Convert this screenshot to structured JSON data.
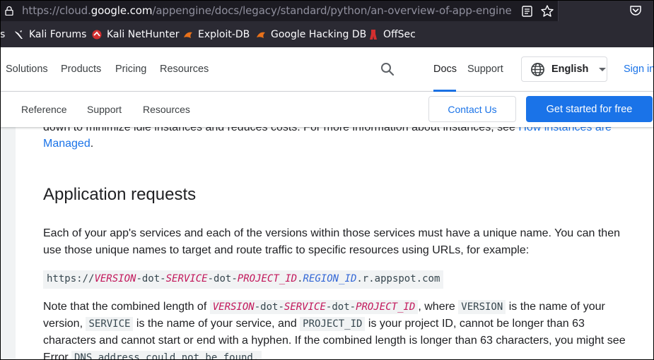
{
  "browser": {
    "url_prefix": "https://cloud.",
    "url_host": "google.com",
    "url_path": "/appengine/docs/legacy/standard/python/an-overview-of-app-engine",
    "bookmarks": [
      {
        "label": "s",
        "icon": "truncated"
      },
      {
        "label": "Kali Forums",
        "icon": "kali-forums-icon"
      },
      {
        "label": "Kali NetHunter",
        "icon": "nethunter-icon"
      },
      {
        "label": "Exploit-DB",
        "icon": "exploitdb-icon"
      },
      {
        "label": "Google Hacking DB",
        "icon": "ghdb-icon"
      },
      {
        "label": "OffSec",
        "icon": "offsec-icon"
      }
    ]
  },
  "topnav": {
    "links": [
      "Solutions",
      "Products",
      "Pricing",
      "Resources"
    ],
    "docs": "Docs",
    "support": "Support",
    "language": "English",
    "signin": "Sign in"
  },
  "subnav": {
    "links": [
      "Reference",
      "Support",
      "Resources"
    ],
    "contact": "Contact Us",
    "get_started": "Get started for free"
  },
  "article": {
    "top_text": "down to minimize idle instances and reduces costs. For more information about instances, see ",
    "top_link_1": "How instances are",
    "top_link_2": "Managed",
    "heading": "Application requests",
    "para1_line1": "Each of your app's services and each of the versions within those services must have a unique name. You can then",
    "para1_line2": "use those unique names to target and route traffic to specific resources using URLs, for example:",
    "url_example": {
      "scheme": "https://",
      "version": "VERSION",
      "dot1": "-dot-",
      "service": "SERVICE",
      "dot2": "-dot-",
      "project": "PROJECT_ID",
      "sep": ".",
      "region": "REGION_ID",
      "suffix": ".r.appspot.com"
    },
    "para2": {
      "lead": "Note that the combined length of ",
      "where": ", where ",
      "version_code": "VERSION",
      "is_version": " is the name of your",
      "version_word": "version, ",
      "service_code": "SERVICE",
      "is_service": " is the name of your service, and ",
      "project_code": "PROJECT_ID",
      "is_project": " is your project ID, cannot be longer than 63",
      "line3": "characters and cannot start or end with a hyphen. If the combined length is longer than 63 characters, you might see",
      "line4_lead": "Error ",
      "line4_code": "DNS address could not be found."
    }
  }
}
